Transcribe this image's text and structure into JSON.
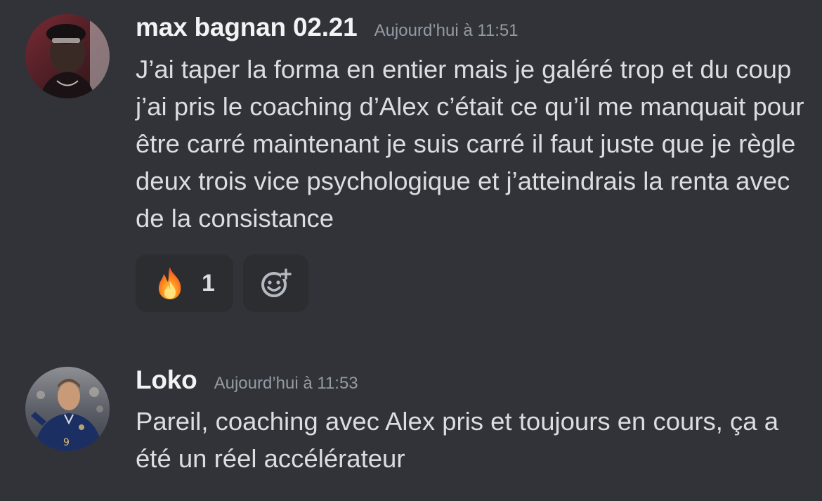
{
  "messages": [
    {
      "username": "max bagnan 02.21",
      "timestamp": "Aujourd’hui à 11:51",
      "text": "J’ai taper la forma en entier mais je galéré trop et du coup j’ai pris le coaching d’Alex c’était ce qu’il me manquait pour être carré maintenant je suis carré il faut juste que je règle deux trois vice psychologique et j’atteindrais la renta avec de la consistance",
      "avatar_icon": "user-avatar-photo",
      "reactions": [
        {
          "emoji": "🔥",
          "icon": "fire-emoji-icon",
          "count": "1"
        }
      ],
      "add_reaction_icon": "add-reaction-icon"
    },
    {
      "username": "Loko",
      "timestamp": "Aujourd’hui à 11:53",
      "text": "Pareil, coaching avec Alex pris et toujours en cours, ça a été un réel accélérateur",
      "avatar_icon": "user-avatar-photo"
    }
  ],
  "colors": {
    "background": "#313338",
    "reaction_bg": "#2b2d31",
    "username": "#f2f3f5",
    "timestamp": "#949ba4",
    "text": "#dbdee1"
  }
}
